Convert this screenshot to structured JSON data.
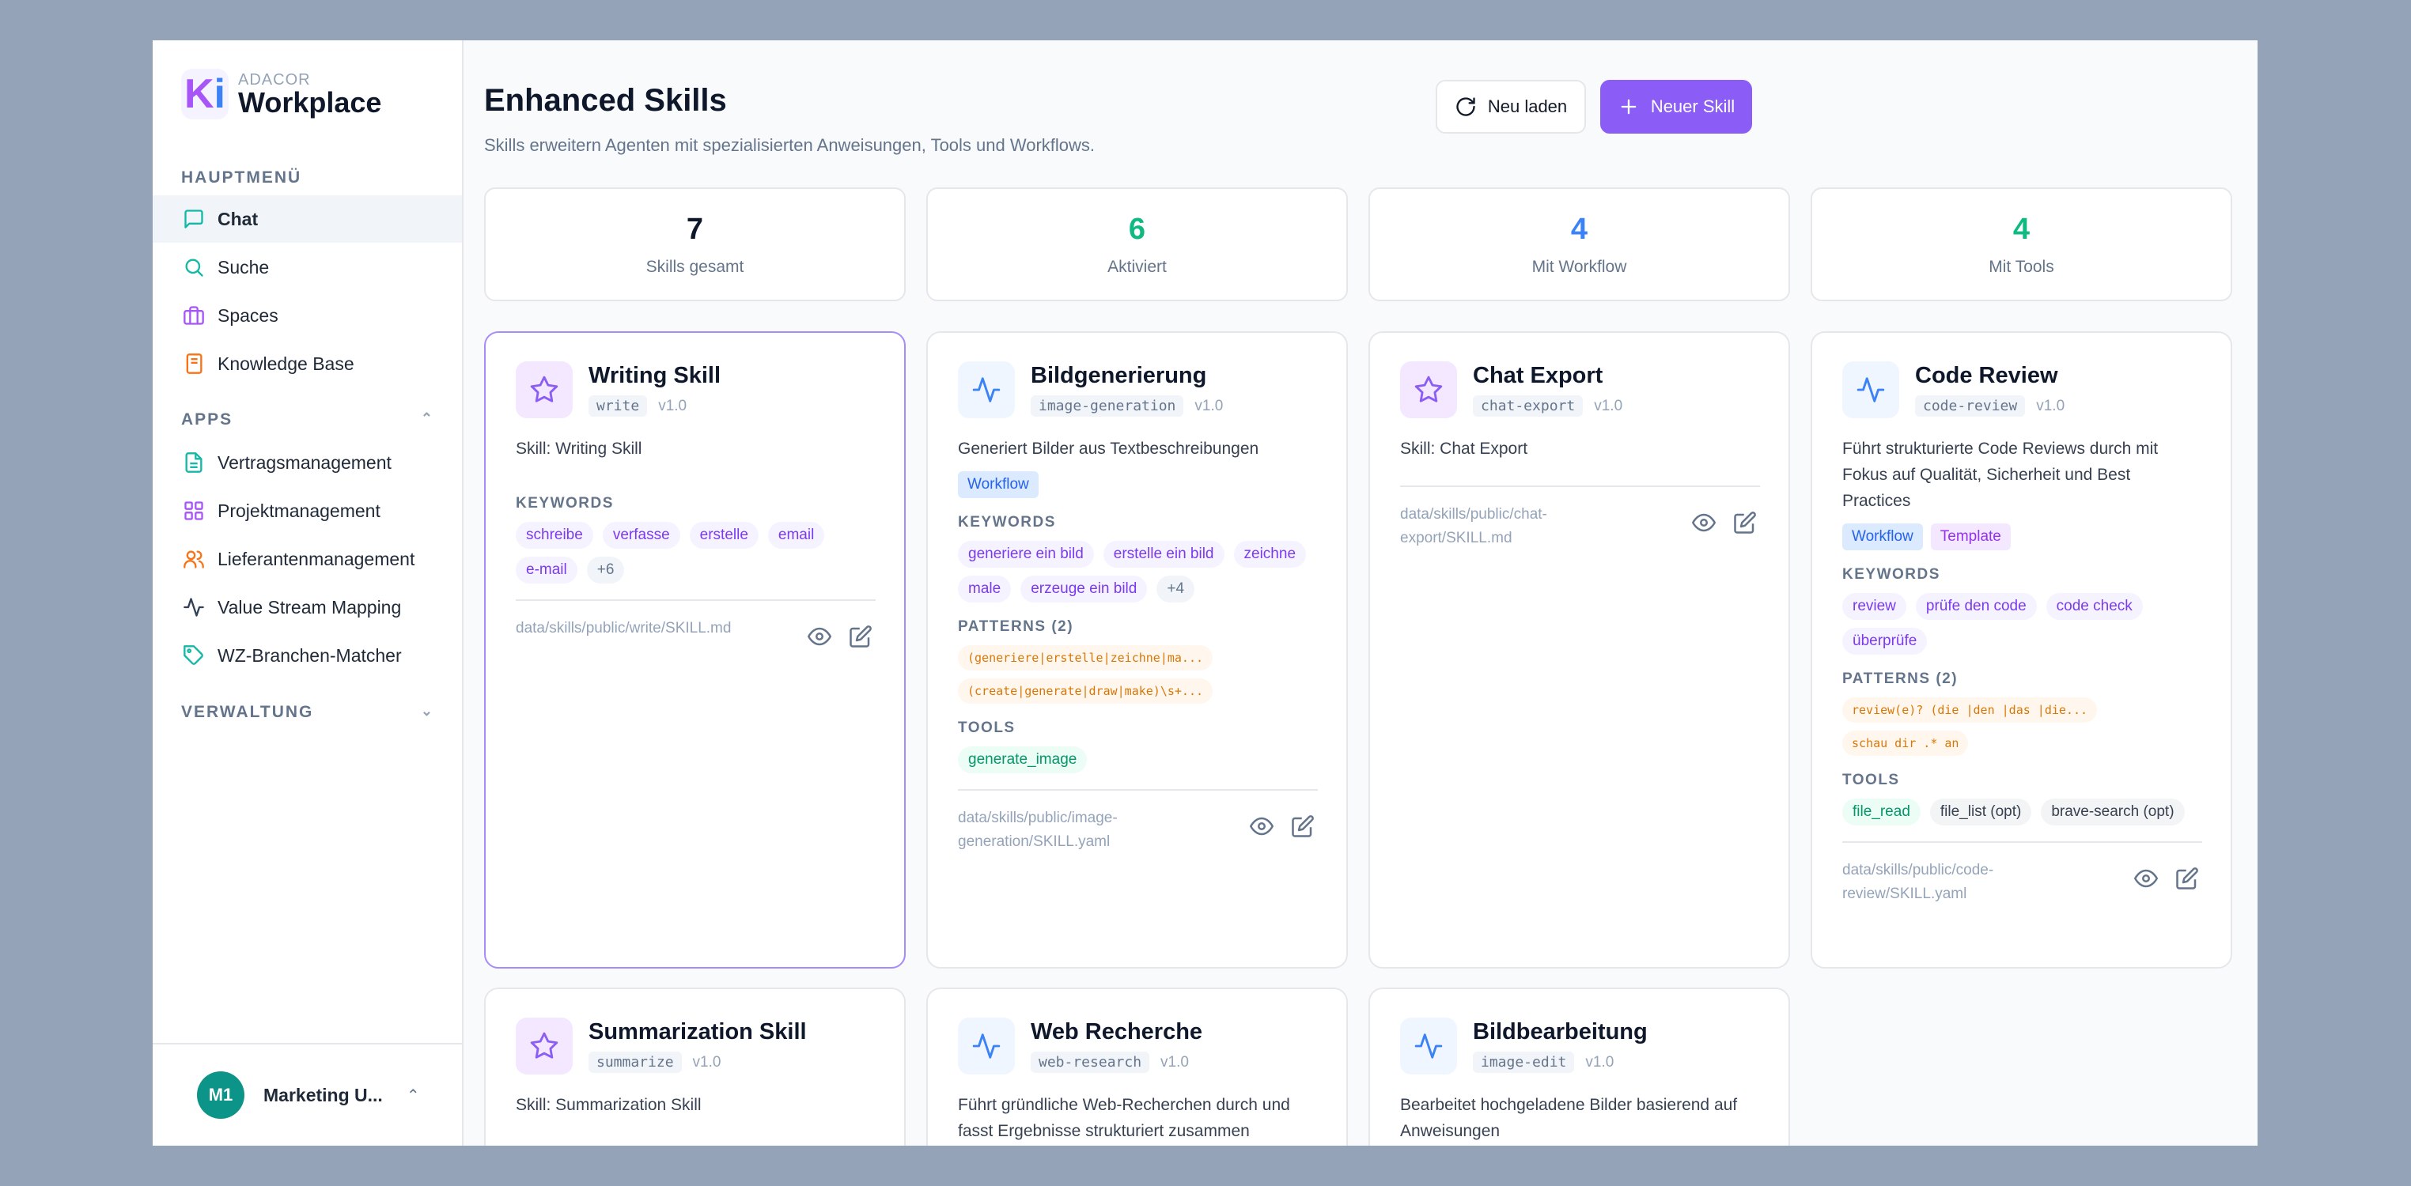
{
  "sidebar": {
    "logo": {
      "mark_k": "K",
      "mark_i": "i",
      "sub": "ADACOR",
      "main": "Workplace"
    },
    "sections": {
      "main_label": "HAUPTMENÜ",
      "apps_label": "APPS",
      "admin_label": "VERWALTUNG"
    },
    "main_items": [
      {
        "label": "Chat",
        "icon": "chat-icon"
      },
      {
        "label": "Suche",
        "icon": "search-icon"
      },
      {
        "label": "Spaces",
        "icon": "briefcase-icon"
      },
      {
        "label": "Knowledge Base",
        "icon": "book-icon"
      }
    ],
    "app_items": [
      {
        "label": "Vertragsmanagement",
        "icon": "document-icon"
      },
      {
        "label": "Projektmanagement",
        "icon": "grid-icon"
      },
      {
        "label": "Lieferantenmanagement",
        "icon": "users-icon"
      },
      {
        "label": "Value Stream Mapping",
        "icon": "activity-icon"
      },
      {
        "label": "WZ-Branchen-Matcher",
        "icon": "tag-icon"
      }
    ],
    "user": {
      "initials": "M1",
      "name": "Marketing U..."
    }
  },
  "header": {
    "title": "Enhanced Skills",
    "subtitle": "Skills erweitern Agenten mit spezialisierten Anweisungen, Tools und Workflows.",
    "reload_label": "Neu laden",
    "new_label": "Neuer Skill"
  },
  "stats": [
    {
      "value": "7",
      "label": "Skills gesamt",
      "color": "#0f172a"
    },
    {
      "value": "6",
      "label": "Aktiviert",
      "color": "#10b981"
    },
    {
      "value": "4",
      "label": "Mit Workflow",
      "color": "#3b82f6"
    },
    {
      "value": "4",
      "label": "Mit Tools",
      "color": "#10b981"
    }
  ],
  "labels": {
    "keywords": "KEYWORDS",
    "patterns": "PATTERNS (2)",
    "tools": "TOOLS"
  },
  "cards": [
    {
      "title": "Writing Skill",
      "slug": "write",
      "version": "v1.0",
      "desc": "Skill: Writing Skill",
      "keywords": [
        "schreibe",
        "verfasse",
        "erstelle",
        "email",
        "e-mail"
      ],
      "more": "+6",
      "path": "data/skills/public/write/SKILL.md"
    },
    {
      "title": "Bildgenerierung",
      "slug": "image-generation",
      "version": "v1.0",
      "desc": "Generiert Bilder aus Textbeschreibungen",
      "badge": "Workflow",
      "keywords": [
        "generiere ein bild",
        "erstelle ein bild",
        "zeichne",
        "male",
        "erzeuge ein bild"
      ],
      "more": "+4",
      "patterns": [
        "(generiere|erstelle|zeichne|ma...",
        "(create|generate|draw|make)\\s+..."
      ],
      "tools": [
        "generate_image"
      ],
      "path": "data/skills/public/image-generation/SKILL.yaml"
    },
    {
      "title": "Chat Export",
      "slug": "chat-export",
      "version": "v1.0",
      "desc": "Skill: Chat Export",
      "path": "data/skills/public/chat-export/SKILL.md"
    },
    {
      "title": "Code Review",
      "slug": "code-review",
      "version": "v1.0",
      "desc": "Führt strukturierte Code Reviews durch mit Fokus auf Qualität, Sicherheit und Best Practices",
      "badge": "Workflow",
      "badge2": "Template",
      "keywords": [
        "review",
        "prüfe den code",
        "code check",
        "überprüfe"
      ],
      "patterns": [
        "review(e)? (die |den |das |die...",
        "schau dir .* an"
      ],
      "tools": [
        "file_read",
        "file_list (opt)",
        "brave-search (opt)"
      ],
      "path": "data/skills/public/code-review/SKILL.yaml"
    },
    {
      "title": "Summarization Skill",
      "slug": "summarize",
      "version": "v1.0",
      "desc": "Skill: Summarization Skill"
    },
    {
      "title": "Web Recherche",
      "slug": "web-research",
      "version": "v1.0",
      "desc": "Führt gründliche Web-Recherchen durch und fasst Ergebnisse strukturiert zusammen"
    },
    {
      "title": "Bildbearbeitung",
      "slug": "image-edit",
      "version": "v1.0",
      "desc": "Bearbeitet hochgeladene Bilder basierend auf Anweisungen"
    }
  ]
}
